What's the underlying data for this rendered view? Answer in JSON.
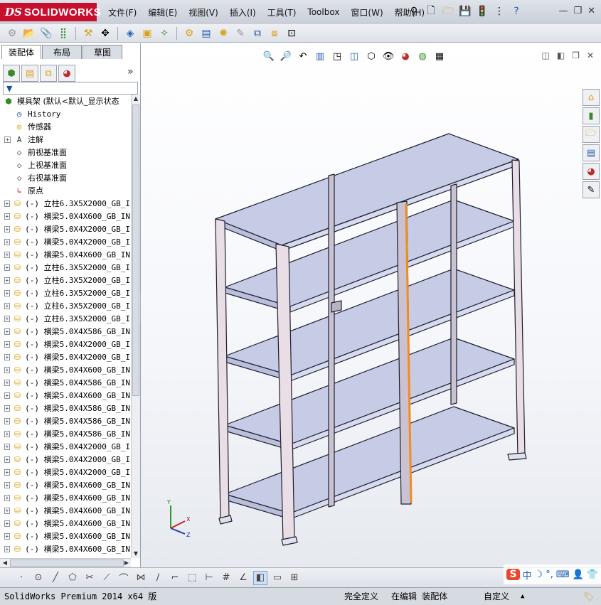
{
  "app": {
    "logo_ds": "DS",
    "logo_name": "SOLIDWORKS"
  },
  "menu": [
    "文件(F)",
    "编辑(E)",
    "视图(V)",
    "插入(I)",
    "工具(T)",
    "Toolbox",
    "窗口(W)",
    "帮助(H)"
  ],
  "sidebar": {
    "tabs": [
      "装配体",
      "布局",
      "草图"
    ],
    "root": "模具架 (默认<默认_显示状态",
    "items": [
      {
        "icon": "history-icon",
        "label": "History",
        "expand": false
      },
      {
        "icon": "sensor-icon",
        "label": "传感器",
        "expand": false
      },
      {
        "icon": "annotation-icon",
        "label": "注解",
        "expand": true
      },
      {
        "icon": "plane-icon",
        "label": "前视基准面",
        "expand": false
      },
      {
        "icon": "plane-icon",
        "label": "上视基准面",
        "expand": false
      },
      {
        "icon": "plane-icon",
        "label": "右视基准面",
        "expand": false
      },
      {
        "icon": "origin-icon",
        "label": "原点",
        "expand": false
      },
      {
        "icon": "part-icon",
        "label": "(-) 立柱6.3X5X2000_GB_I",
        "expand": true
      },
      {
        "icon": "part-icon",
        "label": "(-) 横梁5.0X4X600_GB_IN",
        "expand": true
      },
      {
        "icon": "part-icon",
        "label": "(-) 横梁5.0X4X2000_GB_I",
        "expand": true
      },
      {
        "icon": "part-icon",
        "label": "(-) 横梁5.0X4X2000_GB_I",
        "expand": true
      },
      {
        "icon": "part-icon",
        "label": "(-) 横梁5.0X4X600_GB_IN",
        "expand": true
      },
      {
        "icon": "part-icon",
        "label": "(-) 立柱6.3X5X2000_GB_I",
        "expand": true
      },
      {
        "icon": "part-icon",
        "label": "(-) 立柱6.3X5X2000_GB_I",
        "expand": true
      },
      {
        "icon": "part-icon",
        "label": "(-) 立柱6.3X5X2000_GB_I",
        "expand": true
      },
      {
        "icon": "part-icon",
        "label": "(-) 立柱6.3X5X2000_GB_I",
        "expand": true
      },
      {
        "icon": "part-icon",
        "label": "(-) 立柱6.3X5X2000_GB_I",
        "expand": true
      },
      {
        "icon": "part-icon",
        "label": "(-) 横梁5.0X4X586_GB_IN",
        "expand": true
      },
      {
        "icon": "part-icon",
        "label": "(-) 横梁5.0X4X2000_GB_I",
        "expand": true
      },
      {
        "icon": "part-icon",
        "label": "(-) 横梁5.0X4X2000_GB_I",
        "expand": true
      },
      {
        "icon": "part-icon",
        "label": "(-) 横梁5.0X4X600_GB_IN",
        "expand": true
      },
      {
        "icon": "part-icon",
        "label": "(-) 横梁5.0X4X586_GB_IN",
        "expand": true
      },
      {
        "icon": "part-icon",
        "label": "(-) 横梁5.0X4X600_GB_IN",
        "expand": true
      },
      {
        "icon": "part-icon",
        "label": "(-) 横梁5.0X4X586_GB_IN",
        "expand": true
      },
      {
        "icon": "part-icon",
        "label": "(-) 横梁5.0X4X586_GB_IN",
        "expand": true
      },
      {
        "icon": "part-icon",
        "label": "(-) 横梁5.0X4X586_GB_IN",
        "expand": true
      },
      {
        "icon": "part-icon",
        "label": "(-) 横梁5.0X4X2000_GB_I",
        "expand": true
      },
      {
        "icon": "part-icon",
        "label": "(-) 横梁5.0X4X2000_GB_I",
        "expand": true
      },
      {
        "icon": "part-icon",
        "label": "(-) 横梁5.0X4X2000_GB_I",
        "expand": true
      },
      {
        "icon": "part-icon",
        "label": "(-) 横梁5.0X4X600_GB_IN",
        "expand": true
      },
      {
        "icon": "part-icon",
        "label": "(-) 横梁5.0X4X600_GB_IN",
        "expand": true
      },
      {
        "icon": "part-icon",
        "label": "(-) 横梁5.0X4X600_GB_IN",
        "expand": true
      },
      {
        "icon": "part-icon",
        "label": "(-) 横梁5.0X4X600_GB_IN",
        "expand": true
      },
      {
        "icon": "part-icon",
        "label": "(-) 横梁5.0X4X600_GB_IN",
        "expand": true
      },
      {
        "icon": "part-icon",
        "label": "(-) 横梁5.0X4X600_GB_IN",
        "expand": true
      }
    ]
  },
  "viewport": {
    "triad": {
      "x": "X",
      "y": "Y",
      "z": "Z"
    },
    "colors": {
      "shelf": "#c6cbe6",
      "frame": "#e9dde6",
      "edge": "#1f1f2e",
      "highlight": "#f28c1e"
    }
  },
  "ime": {
    "logo": "S",
    "lang": "中"
  },
  "status": {
    "version": "SolidWorks Premium 2014 x64 版",
    "definition": "完全定义",
    "mode": "在编辑 装配体",
    "custom": "自定义"
  }
}
